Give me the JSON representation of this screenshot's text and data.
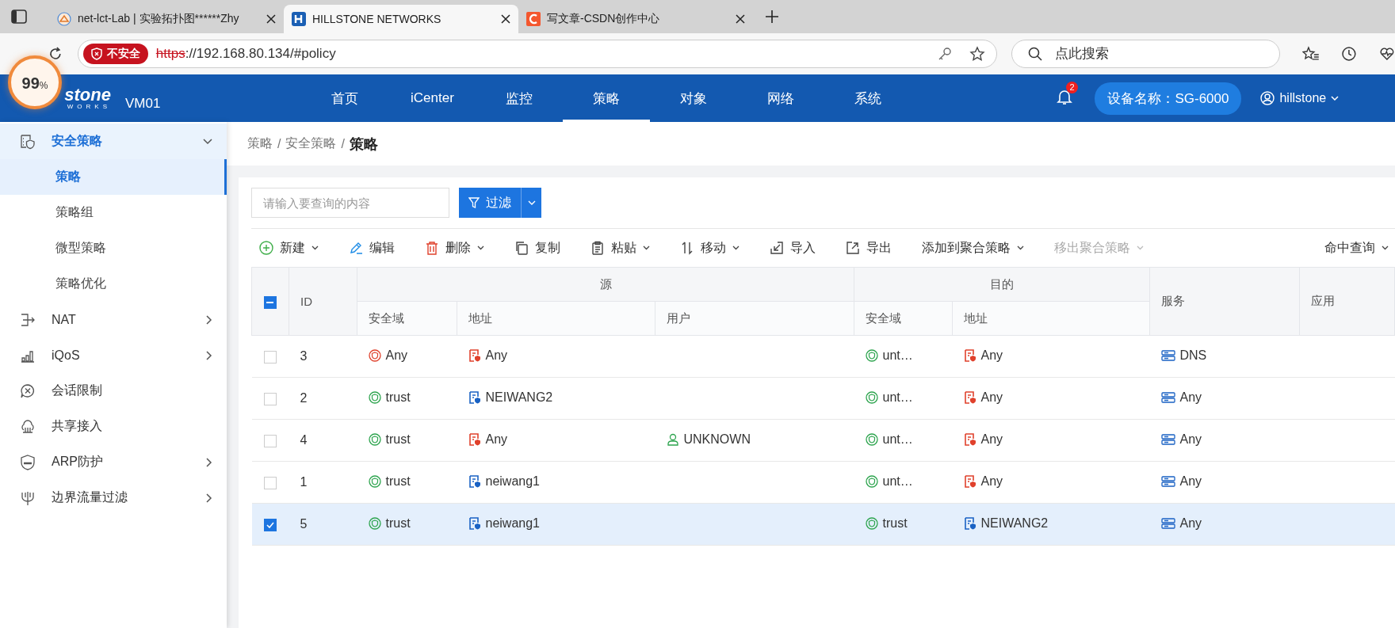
{
  "browser": {
    "tabs": [
      {
        "kind": "lab",
        "title": "net-lct-Lab | 实验拓扑图******Zhy",
        "selected": false
      },
      {
        "kind": "hillstone",
        "title": "HILLSTONE NETWORKS",
        "selected": true
      },
      {
        "kind": "csdn",
        "title": "写文章-CSDN创作中心",
        "selected": false
      }
    ],
    "security": "不安全",
    "scheme": "https",
    "address": "://192.168.80.134/#policy",
    "search_placeholder": "点此搜索"
  },
  "speed_badge": {
    "value": "99",
    "unit": "%"
  },
  "header": {
    "logo": "stone",
    "logo_sub": "WORKS",
    "device": "VM01",
    "nav": [
      {
        "label": "首页",
        "selected": false
      },
      {
        "label": "iCenter",
        "selected": false
      },
      {
        "label": "监控",
        "selected": false
      },
      {
        "label": "策略",
        "selected": true
      },
      {
        "label": "对象",
        "selected": false
      },
      {
        "label": "网络",
        "selected": false
      },
      {
        "label": "系统",
        "selected": false
      }
    ],
    "notifications": "2",
    "device_name": "设备名称：SG-6000",
    "user": "hillstone"
  },
  "sidebar": [
    {
      "kind": "policy",
      "label": "安全策略",
      "submenu": true,
      "expanded": true,
      "children": [
        {
          "label": "策略",
          "selected": true
        },
        {
          "label": "策略组",
          "selected": false
        },
        {
          "label": "微型策略",
          "selected": false
        },
        {
          "label": "策略优化",
          "selected": false
        }
      ]
    },
    {
      "kind": "nat",
      "label": "NAT",
      "submenu": true,
      "expanded": false
    },
    {
      "kind": "qos",
      "label": "iQoS",
      "submenu": true,
      "expanded": false
    },
    {
      "kind": "session",
      "label": "会话限制",
      "submenu": false,
      "expanded": false
    },
    {
      "kind": "share",
      "label": "共享接入",
      "submenu": false,
      "expanded": false
    },
    {
      "kind": "arp",
      "label": "ARP防护",
      "submenu": true,
      "expanded": false
    },
    {
      "kind": "filter",
      "label": "边界流量过滤",
      "submenu": true,
      "expanded": false
    }
  ],
  "breadcrumb": {
    "separator": "/",
    "items": [
      "策略",
      "安全策略",
      "策略"
    ]
  },
  "search": {
    "placeholder": "请输入要查询的内容"
  },
  "filter_button": "过滤",
  "toolbar": [
    {
      "kind": "add",
      "label": "新建",
      "dropdown": true,
      "disabled": false
    },
    {
      "kind": "edit",
      "label": "编辑",
      "dropdown": false,
      "disabled": false
    },
    {
      "kind": "delete",
      "label": "删除",
      "dropdown": true,
      "disabled": false
    },
    {
      "kind": "copy",
      "label": "复制",
      "dropdown": false,
      "disabled": false
    },
    {
      "kind": "paste",
      "label": "粘贴",
      "dropdown": true,
      "disabled": false
    },
    {
      "kind": "move",
      "label": "移动",
      "dropdown": true,
      "disabled": false
    },
    {
      "kind": "import",
      "label": "导入",
      "dropdown": false,
      "disabled": false
    },
    {
      "kind": "export",
      "label": "导出",
      "dropdown": false,
      "disabled": false
    },
    {
      "kind": "none",
      "label": "添加到聚合策略",
      "dropdown": true,
      "disabled": false
    },
    {
      "kind": "none",
      "label": "移出聚合策略",
      "dropdown": true,
      "disabled": true
    }
  ],
  "hit_query": "命中查询",
  "table": {
    "select_all": {
      "indeterminate": true
    },
    "id_header": "ID",
    "source_header": "源",
    "dest_header": "目的",
    "service_header": "服务",
    "app_header": "应用",
    "source_columns": [
      "安全域",
      "地址",
      "用户"
    ],
    "dest_columns": [
      "安全域",
      "地址"
    ],
    "rows": [
      {
        "id": "3",
        "selected": false,
        "src_zone": {
          "text": "Any",
          "color": "#e0412c"
        },
        "src_addr": {
          "text": "Any",
          "color": "#e0412c"
        },
        "dst_zone": {
          "text": "unt…",
          "color": "#2da44e"
        },
        "dst_addr": {
          "text": "Any",
          "color": "#e0412c"
        },
        "service": "DNS"
      },
      {
        "id": "2",
        "selected": false,
        "src_zone": {
          "text": "trust",
          "color": "#2da44e"
        },
        "src_addr": {
          "text": "NEIWANG2",
          "color": "#1a62c4"
        },
        "dst_zone": {
          "text": "unt…",
          "color": "#2da44e"
        },
        "dst_addr": {
          "text": "Any",
          "color": "#e0412c"
        },
        "service": "Any"
      },
      {
        "id": "4",
        "selected": false,
        "src_zone": {
          "text": "trust",
          "color": "#2da44e"
        },
        "src_addr": {
          "text": "Any",
          "color": "#e0412c"
        },
        "user": "UNKNOWN",
        "dst_zone": {
          "text": "unt…",
          "color": "#2da44e"
        },
        "dst_addr": {
          "text": "Any",
          "color": "#e0412c"
        },
        "service": "Any"
      },
      {
        "id": "1",
        "selected": false,
        "src_zone": {
          "text": "trust",
          "color": "#2da44e"
        },
        "src_addr": {
          "text": "neiwang1",
          "color": "#1a62c4"
        },
        "dst_zone": {
          "text": "unt…",
          "color": "#2da44e"
        },
        "dst_addr": {
          "text": "Any",
          "color": "#e0412c"
        },
        "service": "Any"
      },
      {
        "id": "5",
        "selected": true,
        "src_zone": {
          "text": "trust",
          "color": "#2da44e"
        },
        "src_addr": {
          "text": "neiwang1",
          "color": "#1a62c4"
        },
        "dst_zone": {
          "text": "trust",
          "color": "#2da44e"
        },
        "dst_addr": {
          "text": "NEIWANG2",
          "color": "#1a62c4"
        },
        "service": "Any"
      }
    ]
  }
}
